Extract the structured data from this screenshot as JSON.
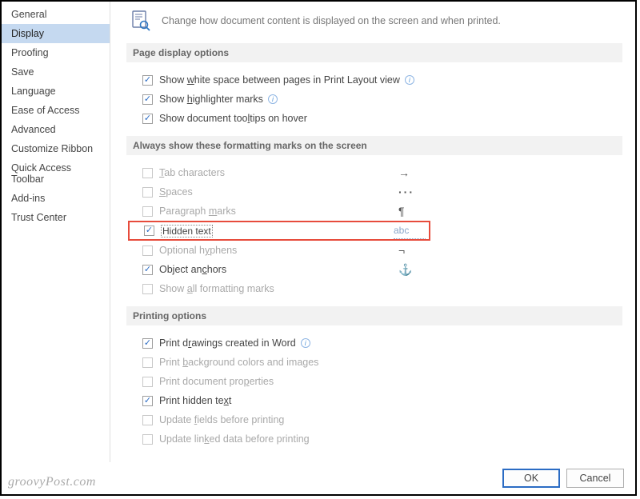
{
  "sidebar": {
    "items": [
      {
        "label": "General"
      },
      {
        "label": "Display"
      },
      {
        "label": "Proofing"
      },
      {
        "label": "Save"
      },
      {
        "label": "Language"
      },
      {
        "label": "Ease of Access"
      },
      {
        "label": "Advanced"
      },
      {
        "label": "Customize Ribbon"
      },
      {
        "label": "Quick Access Toolbar"
      },
      {
        "label": "Add-ins"
      },
      {
        "label": "Trust Center"
      }
    ],
    "selected_index": 1
  },
  "header": {
    "text": "Change how document content is displayed on the screen and when printed."
  },
  "sections": {
    "page_display": {
      "title": "Page display options",
      "options": {
        "white_space": {
          "pre": "Show ",
          "ul": "w",
          "post": "hite space between pages in Print Layout view",
          "checked": true,
          "info": true
        },
        "highlighter": {
          "pre": "Show ",
          "ul": "h",
          "post": "ighlighter marks",
          "checked": true,
          "info": true
        },
        "tooltips": {
          "pre": "Show document too",
          "ul": "l",
          "post": "tips on hover",
          "checked": true,
          "info": false
        }
      }
    },
    "formatting_marks": {
      "title": "Always show these formatting marks on the screen",
      "options": {
        "tab": {
          "ul": "T",
          "post": "ab characters",
          "checked": false,
          "symbol": "→"
        },
        "spaces": {
          "ul": "S",
          "post": "paces",
          "checked": false,
          "symbol": "···"
        },
        "para": {
          "pre": "Paragraph ",
          "ul": "m",
          "post": "arks",
          "checked": false,
          "symbol": "¶"
        },
        "hidden": {
          "pre": "Hi",
          "ul": "d",
          "post": "den text",
          "checked": true,
          "symbol": "abc"
        },
        "hyphens": {
          "pre": "Optional h",
          "ul": "y",
          "post": "phens",
          "checked": false,
          "symbol": "¬"
        },
        "anchors": {
          "pre": "Object an",
          "ul": "c",
          "post": "hors",
          "checked": true,
          "symbol": "⚓"
        },
        "all": {
          "pre": "Show ",
          "ul": "a",
          "post": "ll formatting marks",
          "checked": false
        }
      }
    },
    "printing": {
      "title": "Printing options",
      "options": {
        "drawings": {
          "pre": "Print d",
          "ul": "r",
          "post": "awings created in Word",
          "checked": true,
          "info": true
        },
        "bg": {
          "pre": "Print ",
          "ul": "b",
          "post": "ackground colors and images",
          "checked": false
        },
        "props": {
          "pre": "Print document pro",
          "ul": "p",
          "post": "erties",
          "checked": false
        },
        "hidden": {
          "pre": "Print hidden te",
          "ul": "x",
          "post": "t",
          "checked": true
        },
        "fields": {
          "pre": "Update ",
          "ul": "f",
          "post": "ields before printing",
          "checked": false
        },
        "linked": {
          "pre": "Update lin",
          "ul": "k",
          "post": "ed data before printing",
          "checked": false
        }
      }
    }
  },
  "buttons": {
    "ok": "OK",
    "cancel": "Cancel"
  },
  "watermark": "groovyPost.com"
}
